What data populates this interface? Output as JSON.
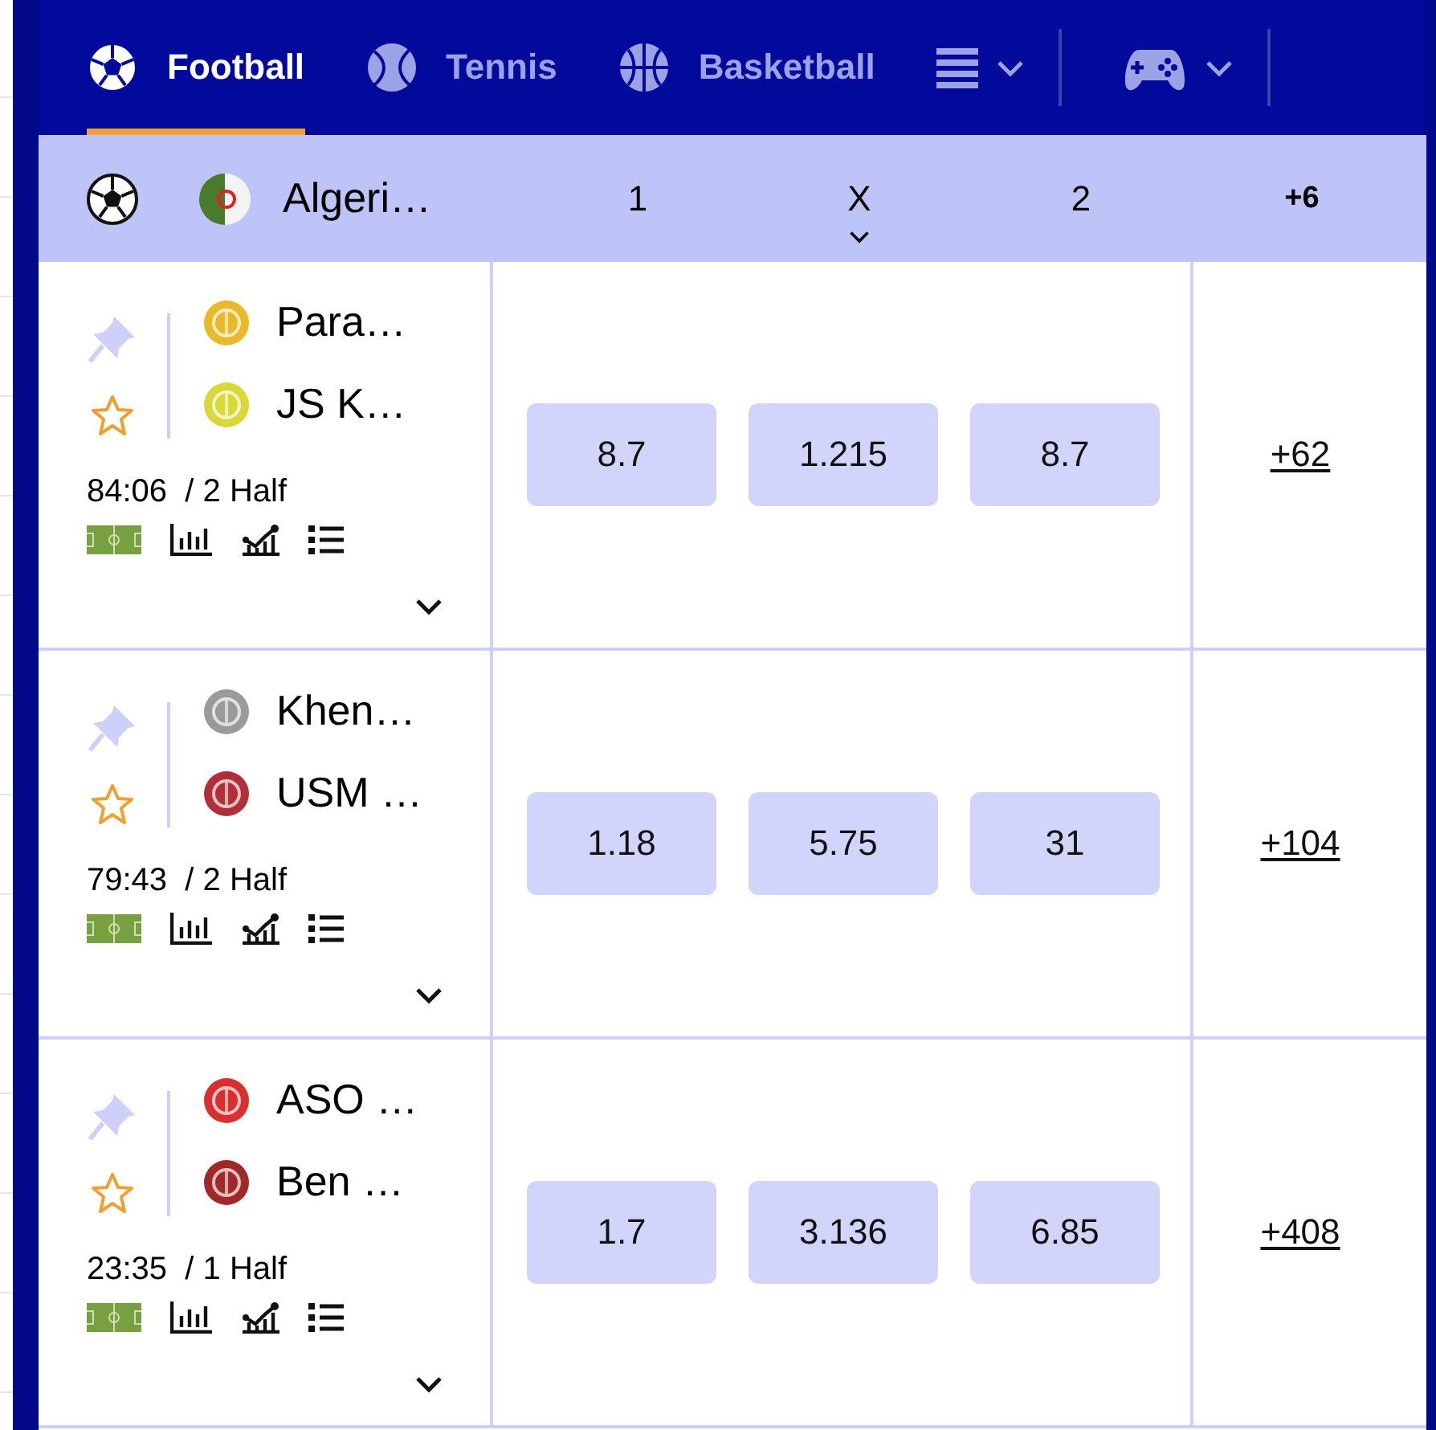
{
  "tabs": [
    {
      "label": "Football",
      "kind": "football",
      "selected": true
    },
    {
      "label": "Tennis",
      "kind": "tennis",
      "selected": false
    },
    {
      "label": "Basketball",
      "kind": "basketball",
      "selected": false
    }
  ],
  "league": {
    "name": "Algeri…",
    "columns": [
      "1",
      "X",
      "2"
    ],
    "more": "+6"
  },
  "matches": [
    {
      "home": {
        "name": "Para…",
        "color": "#e9b92a"
      },
      "away": {
        "name": "JS K…",
        "color": "#d8d83a"
      },
      "time": "84:06",
      "period": "/ 2 Half",
      "pinned": false,
      "favorite": false,
      "odds": [
        "8.7",
        "1.215",
        "8.7"
      ],
      "more": "+62"
    },
    {
      "home": {
        "name": "Khen…",
        "color": "#9a9a9a"
      },
      "away": {
        "name": "USM …",
        "color": "#b0303a"
      },
      "time": "79:43",
      "period": "/ 2 Half",
      "pinned": false,
      "favorite": false,
      "odds": [
        "1.18",
        "5.75",
        "31"
      ],
      "more": "+104"
    },
    {
      "home": {
        "name": "ASO …",
        "color": "#d83030"
      },
      "away": {
        "name": "Ben …",
        "color": "#a02828"
      },
      "time": "23:35",
      "period": "/ 1 Half",
      "pinned": false,
      "favorite": false,
      "odds": [
        "1.7",
        "3.136",
        "6.85"
      ],
      "more": "+408"
    }
  ]
}
